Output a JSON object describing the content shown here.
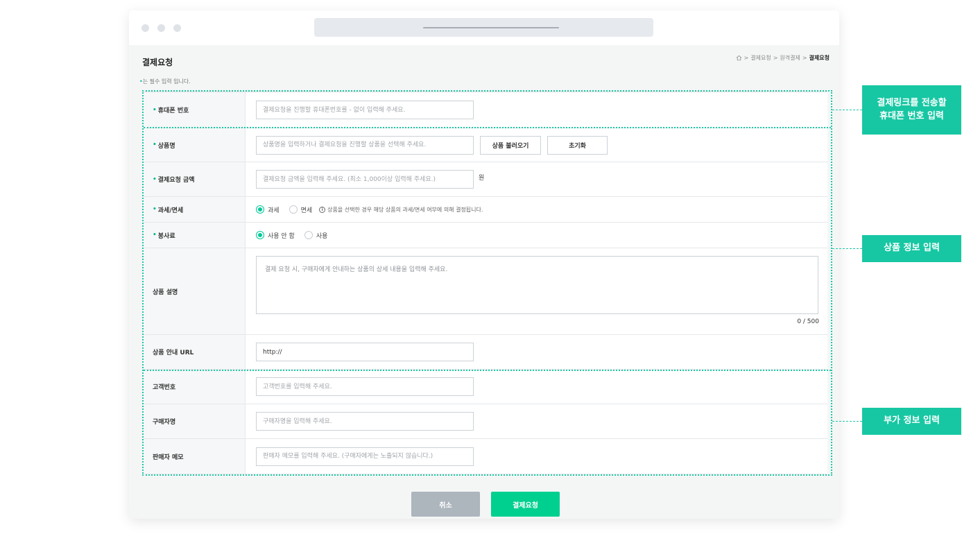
{
  "page": {
    "title": "결제요청",
    "breadcrumb": [
      "결제요청",
      "원격결제",
      "결제요청"
    ],
    "required_note": "는 필수 입력 입니다.",
    "required_mark": "•"
  },
  "form": {
    "phone": {
      "label": "휴대폰 번호",
      "placeholder": "결제요청을 진행할 휴대폰번호를 - 없이 입력해 주세요."
    },
    "product": {
      "label": "상품명",
      "placeholder": "상품명을 입력하거나 결제요청을 진행할 상품을 선택해 주세요.",
      "load_button": "상품 불러오기",
      "reset_button": "초기화"
    },
    "amount": {
      "label": "결제요청 금액",
      "placeholder": "결제요청 금액을 입력해 주세요. (최소 1,000이상 입력해 주세요.)",
      "unit": "원"
    },
    "tax": {
      "label": "과세/면세",
      "options": [
        "과세",
        "면세"
      ],
      "selected": "과세",
      "note": "상품을 선택한 경우 해당 상품의 과세/면세 여부에 의해 결정됩니다."
    },
    "service_fee": {
      "label": "봉사료",
      "options": [
        "사용 안 함",
        "사용"
      ],
      "selected": "사용 안 함"
    },
    "description": {
      "label": "상품 설명",
      "placeholder": "결제 요청 시, 구매자에게 안내하는 상품의 상세 내용을 입력해 주세요.",
      "counter": "0 / 500"
    },
    "url": {
      "label": "상품 안내 URL",
      "value": "http://"
    },
    "customer_no": {
      "label": "고객번호",
      "placeholder": "고객번호를 입력해 주세요."
    },
    "buyer": {
      "label": "구매자명",
      "placeholder": "구매자명을 입력해 주세요."
    },
    "memo": {
      "label": "판매자 메모",
      "placeholder": "판매자 메모를 입력해 주세요. (구매자에게는 노출되지 않습니다.)"
    }
  },
  "actions": {
    "cancel": "취소",
    "submit": "결제요청"
  },
  "annotations": {
    "phone_section": [
      "결제링크를 전송할",
      "휴대폰 번호 입력"
    ],
    "product_section": "상품 정보 입력",
    "extra_section": "부가 정보 입력"
  },
  "colors": {
    "accent": "#00d08f",
    "annotation": "#17c7a3",
    "cancel": "#adb5bd"
  }
}
